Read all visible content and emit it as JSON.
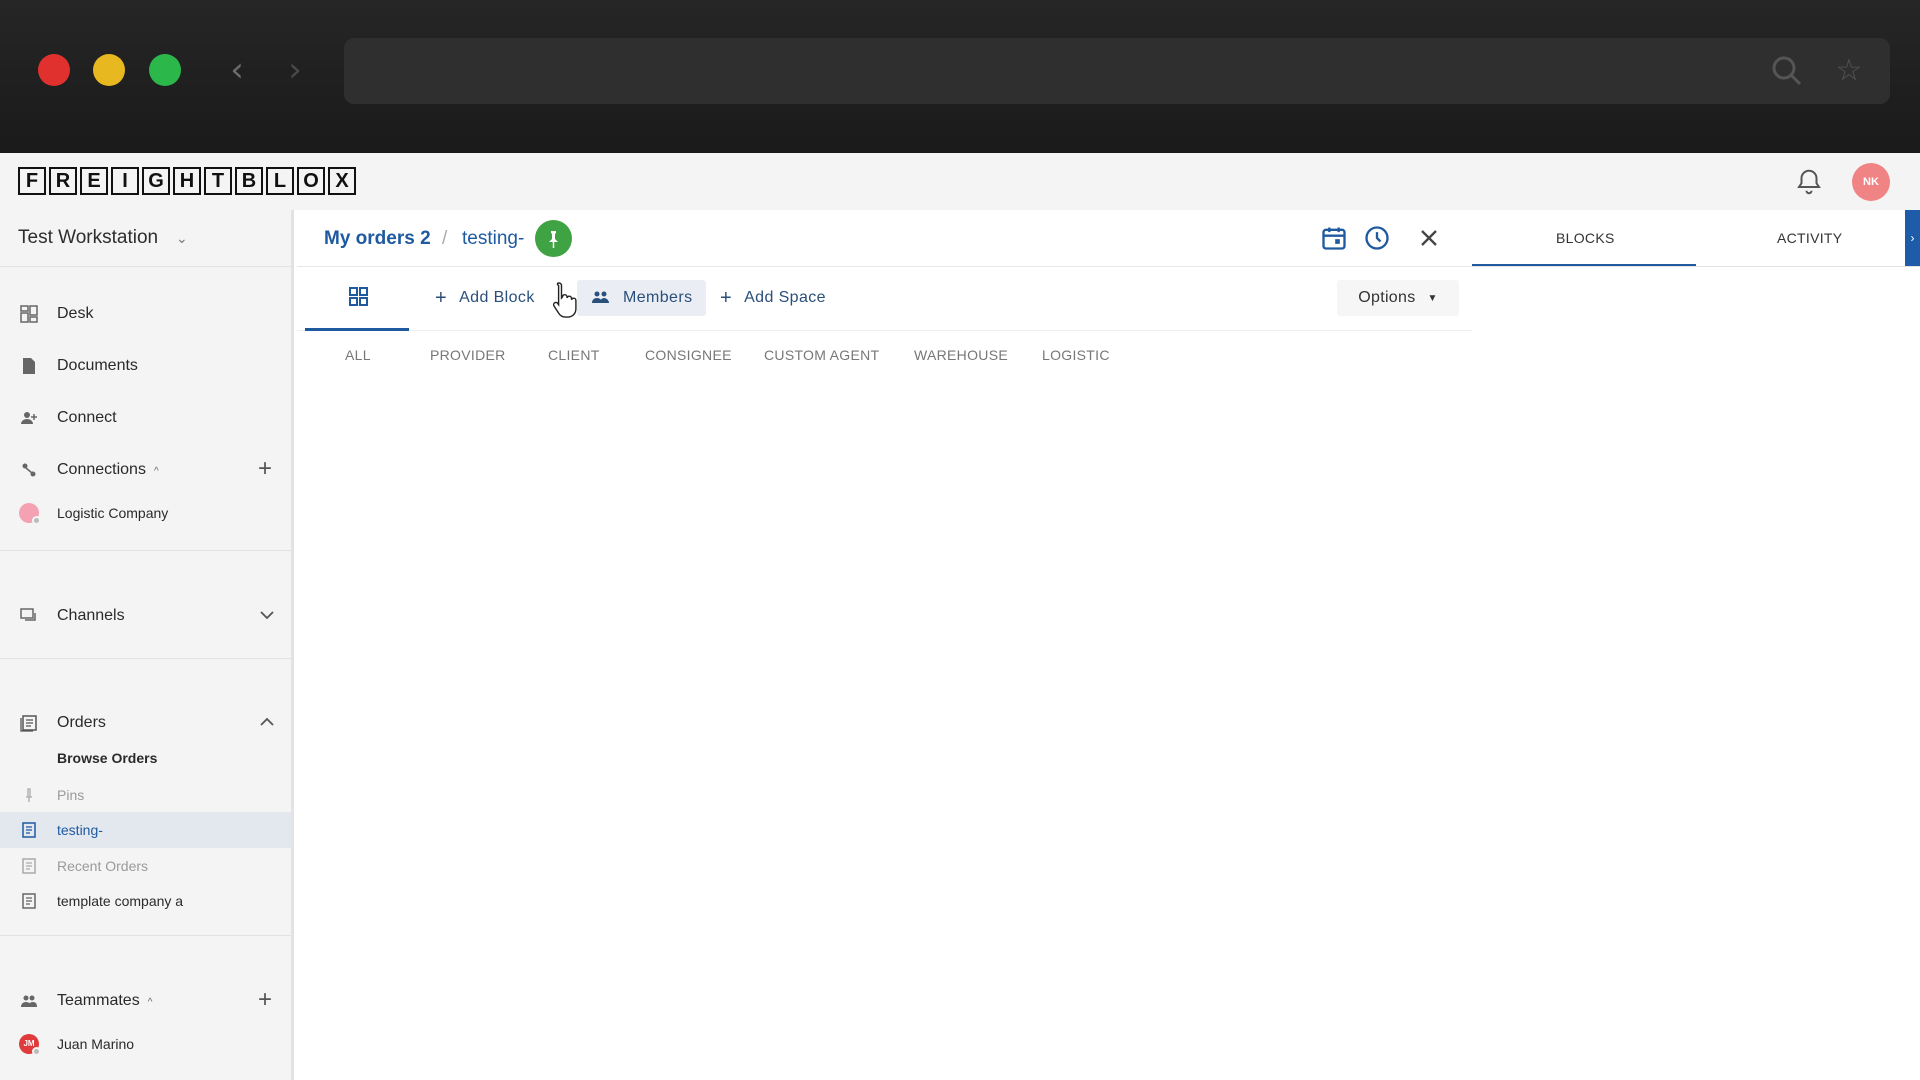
{
  "app": {
    "logo_letters": [
      "F",
      "R",
      "E",
      "I",
      "G",
      "H",
      "T",
      "B",
      "L",
      "O",
      "X"
    ],
    "user_initials": "NK",
    "accent_color": "#1f5aa0"
  },
  "sidebar": {
    "workspace": "Test Workstation",
    "items": {
      "desk": "Desk",
      "documents": "Documents",
      "connect": "Connect",
      "connections": "Connections",
      "logistic_company": "Logistic Company",
      "channels": "Channels",
      "orders": "Orders",
      "browse_orders": "Browse Orders",
      "pins": "Pins",
      "testing": "testing-",
      "recent_orders": "Recent Orders",
      "template_company": "template company a",
      "teammates": "Teammates",
      "juan_marino": "Juan Marino",
      "juan_initials": "JM"
    }
  },
  "breadcrumb": {
    "parent": "My orders 2",
    "separator": "/",
    "current": "testing-"
  },
  "toolbar": {
    "add_block": "Add Block",
    "members": "Members",
    "add_space": "Add Space",
    "options": "Options"
  },
  "filters": [
    "ALL",
    "PROVIDER",
    "CLIENT",
    "CONSIGNEE",
    "CUSTOM AGENT",
    "WAREHOUSE",
    "LOGISTIC"
  ],
  "right_panel": {
    "tabs": [
      "BLOCKS",
      "ACTIVITY"
    ]
  }
}
